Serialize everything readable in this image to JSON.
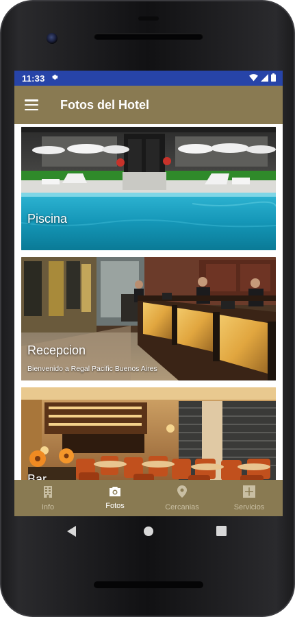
{
  "status_bar": {
    "time": "11:33",
    "icons": [
      "settings-icon",
      "wifi-icon",
      "signal-icon",
      "battery-icon"
    ]
  },
  "app_bar": {
    "menu_icon": "menu-icon",
    "title": "Fotos del Hotel"
  },
  "gallery": [
    {
      "caption": "Piscina",
      "subcaption": ""
    },
    {
      "caption": "Recepcion",
      "subcaption": "Bienvenido a Regal Pacific Buenos Aires"
    },
    {
      "caption": "Bar",
      "subcaption": ""
    }
  ],
  "bottom_nav": {
    "active": "Fotos",
    "items": [
      {
        "label": "Info",
        "icon": "building-icon"
      },
      {
        "label": "Fotos",
        "icon": "camera-icon"
      },
      {
        "label": "Cercanias",
        "icon": "location-pin-icon"
      },
      {
        "label": "Servicios",
        "icon": "services-icon"
      }
    ]
  },
  "colors": {
    "status_bar": "#2744a8",
    "app_bar": "#897a52",
    "bottom_nav": "#897a52",
    "nav_active": "#ffffff",
    "nav_inactive": "#c9bfa3"
  }
}
